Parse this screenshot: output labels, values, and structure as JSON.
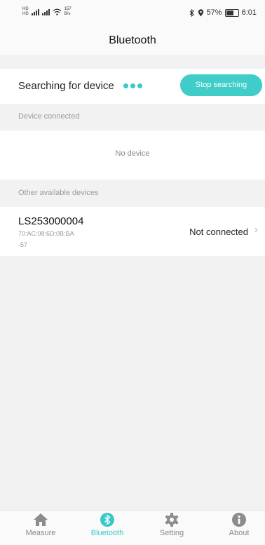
{
  "status_bar": {
    "sim1": "HD",
    "sim2": "HD",
    "net_speed": "157",
    "net_speed_unit": "B/s",
    "battery": "57%",
    "time": "6:01"
  },
  "header": {
    "title": "Bluetooth"
  },
  "search": {
    "label": "Searching for device",
    "button_label": "Stop searching"
  },
  "connected": {
    "header": "Device connected",
    "empty_text": "No device"
  },
  "available": {
    "header": "Other available devices",
    "devices": [
      {
        "name": "LS253000004",
        "mac": "70:AC:08:6D:0B:BA",
        "rssi": "-57",
        "status": "Not connected"
      }
    ]
  },
  "tabs": [
    {
      "label": "Measure",
      "icon": "home-icon",
      "active": false
    },
    {
      "label": "Bluetooth",
      "icon": "bluetooth-icon",
      "active": true
    },
    {
      "label": "Setting",
      "icon": "gear-icon",
      "active": false
    },
    {
      "label": "About",
      "icon": "info-icon",
      "active": false
    }
  ],
  "colors": {
    "accent": "#3cc8c8",
    "background": "#f2f2f2"
  }
}
